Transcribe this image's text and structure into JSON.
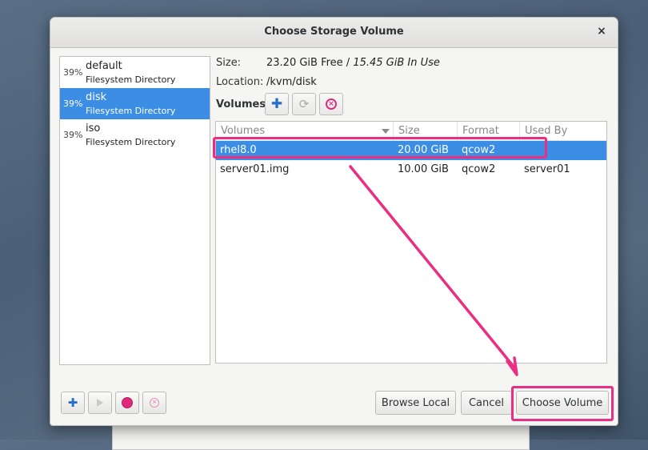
{
  "dialog": {
    "title": "Choose Storage Volume",
    "close_glyph": "×"
  },
  "pools": [
    {
      "percent": "39%",
      "name": "default",
      "type": "Filesystem Directory",
      "selected": false
    },
    {
      "percent": "39%",
      "name": "disk",
      "type": "Filesystem Directory",
      "selected": true
    },
    {
      "percent": "39%",
      "name": "iso",
      "type": "Filesystem Directory",
      "selected": false
    }
  ],
  "info": {
    "size_label": "Size:",
    "size_free": "23.20 GiB Free / ",
    "size_inuse": "15.45 GiB In Use",
    "location_label": "Location:",
    "location_value": "/kvm/disk"
  },
  "volumes_toolbar": {
    "label": "Volumes",
    "add_glyph": "✚",
    "refresh_glyph": "⟳",
    "delete_glyph": "×"
  },
  "table": {
    "columns": [
      "Volumes",
      "Size",
      "Format",
      "Used By"
    ],
    "rows": [
      {
        "name": "rhel8.0",
        "size": "20.00 GiB",
        "format": "qcow2",
        "used_by": "",
        "selected": true
      },
      {
        "name": "server01.img",
        "size": "10.00 GiB",
        "format": "qcow2",
        "used_by": "server01",
        "selected": false
      }
    ]
  },
  "pool_toolbar": {
    "add_glyph": "✚"
  },
  "buttons": {
    "browse_local": "Browse Local",
    "cancel": "Cancel",
    "choose_volume": "Choose Volume"
  },
  "colors": {
    "selection": "#3c8ee5",
    "annotation": "#ea2e82"
  }
}
